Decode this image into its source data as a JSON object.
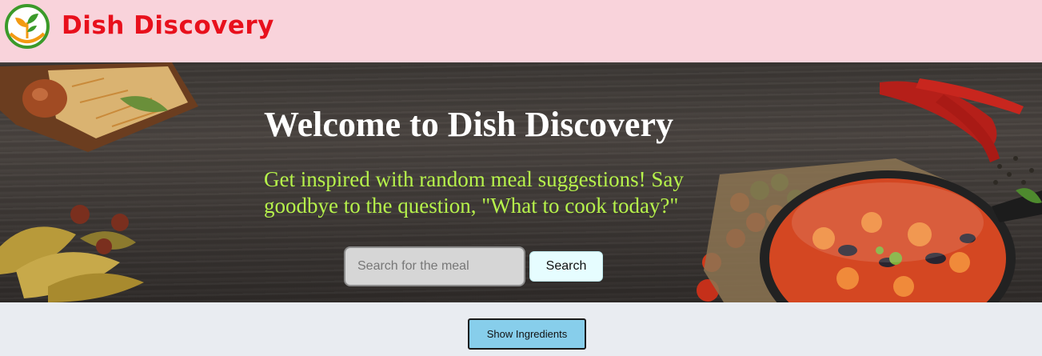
{
  "navbar": {
    "brand": "Dish Discovery",
    "logo_icon": "sprout-leaf-logo-icon",
    "background": "#f9d3db",
    "brand_color": "#e8101c"
  },
  "hero": {
    "title": "Welcome to Dish Discovery",
    "subtitle": "Get inspired with random meal suggestions! Say goodbye to the question, \"What to cook today?\"",
    "subtitle_color": "#b6f24b",
    "search": {
      "placeholder": "Search for the meal",
      "value": "",
      "button_label": "Search"
    }
  },
  "actions": {
    "show_ingredients_label": "Show Ingredients",
    "button_color": "#87ceeb"
  }
}
